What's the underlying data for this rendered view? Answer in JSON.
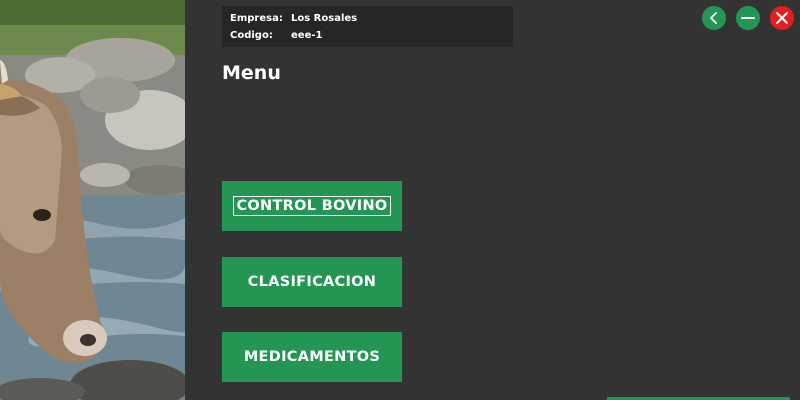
{
  "header": {
    "company_label": "Empresa:",
    "company_value": "Los Rosales",
    "code_label": "Codigo:",
    "code_value": "eee-1"
  },
  "menu": {
    "title": "Menu",
    "buttons": [
      {
        "label": "CONTROL BOVINO",
        "focused": true
      },
      {
        "label": "CLASIFICACION"
      },
      {
        "label": "MEDICAMENTOS"
      }
    ]
  },
  "window_controls": {
    "back_icon": "chevron-left-icon",
    "minimize_icon": "minus-icon",
    "close_icon": "close-icon"
  },
  "colors": {
    "background": "#333333",
    "header_box": "#262626",
    "accent_green": "#239654",
    "close_red": "#e51d1d",
    "text": "#ffffff"
  },
  "decor": {
    "left_image": "photo of a cow drinking from a rocky stream"
  }
}
